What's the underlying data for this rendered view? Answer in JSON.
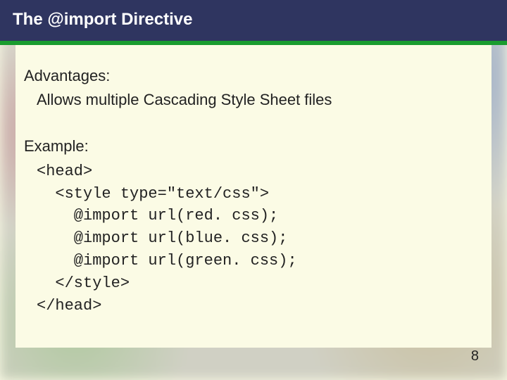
{
  "header": {
    "title": "The @import Directive"
  },
  "body": {
    "advantages_label": "Advantages:",
    "advantages_text": "Allows multiple Cascading Style Sheet files",
    "example_label": "Example:",
    "code": "<head>\n  <style type=\"text/css\">\n    @import url(red. css);\n    @import url(blue. css);\n    @import url(green. css);\n  </style>\n</head>"
  },
  "footer": {
    "page_number": "8"
  }
}
